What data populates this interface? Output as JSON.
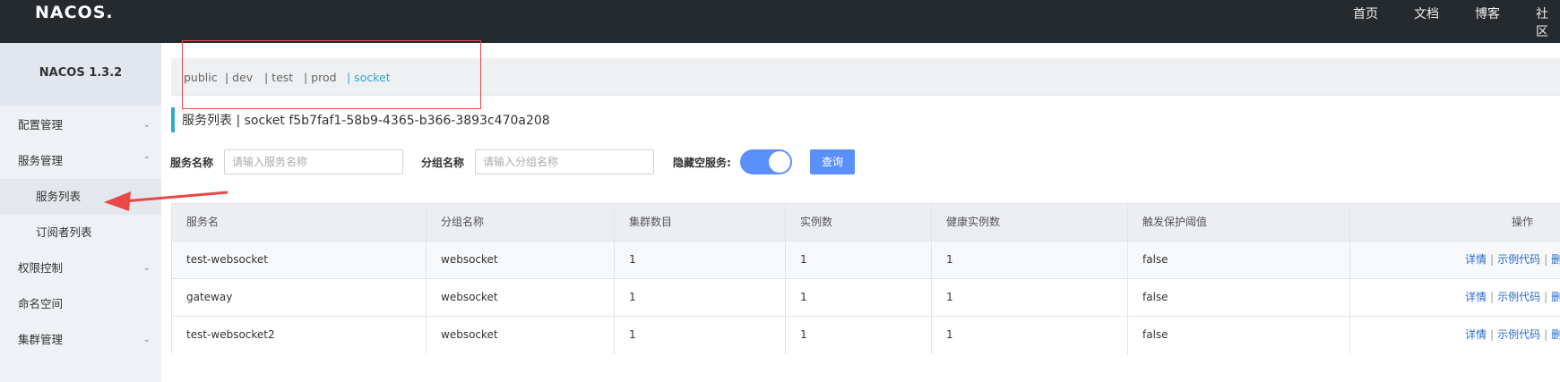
{
  "header": {
    "logo": "NACOS.",
    "nav": [
      "首页",
      "文档",
      "博客",
      "社区"
    ]
  },
  "sidebar": {
    "version": "NACOS 1.3.2",
    "items": [
      {
        "label": "配置管理",
        "chevron": "chevron-down"
      },
      {
        "label": "服务管理",
        "chevron": "chevron-up"
      },
      {
        "label": "服务列表",
        "active": true
      },
      {
        "label": "订阅者列表"
      },
      {
        "label": "权限控制",
        "chevron": "chevron-down"
      },
      {
        "label": "命名空间"
      },
      {
        "label": "集群管理",
        "chevron": "chevron-down"
      }
    ]
  },
  "namespaces": [
    {
      "label": "public"
    },
    {
      "label": "| dev"
    },
    {
      "label": "| test"
    },
    {
      "label": "| prod"
    },
    {
      "label": "| socket",
      "active": true
    }
  ],
  "page": {
    "title": "服务列表 | socket f5b7faf1-58b9-4365-b366-3893c470a208"
  },
  "filters": {
    "service_name_label": "服务名称",
    "service_name_placeholder": "请输入服务名称",
    "group_name_label": "分组名称",
    "group_name_placeholder": "请输入分组名称",
    "hide_empty_label": "隐藏空服务:",
    "hide_empty_on": true,
    "query_label": "查询"
  },
  "table": {
    "columns": [
      "服务名",
      "分组名称",
      "集群数目",
      "实例数",
      "健康实例数",
      "触发保护阈值",
      "操作"
    ],
    "rows": [
      {
        "name": "test-websocket",
        "group": "websocket",
        "clusters": "1",
        "instances": "1",
        "healthy": "1",
        "threshold": "false"
      },
      {
        "name": "gateway",
        "group": "websocket",
        "clusters": "1",
        "instances": "1",
        "healthy": "1",
        "threshold": "false"
      },
      {
        "name": "test-websocket2",
        "group": "websocket",
        "clusters": "1",
        "instances": "1",
        "healthy": "1",
        "threshold": "false"
      }
    ],
    "actions": [
      "详情",
      "示例代码",
      "删"
    ]
  },
  "colors": {
    "header_bg": "#252a2f",
    "accent": "#5b8ff9",
    "ns_active": "#2fa8cf",
    "link": "#2a6acb",
    "annotation": "#e84848"
  }
}
